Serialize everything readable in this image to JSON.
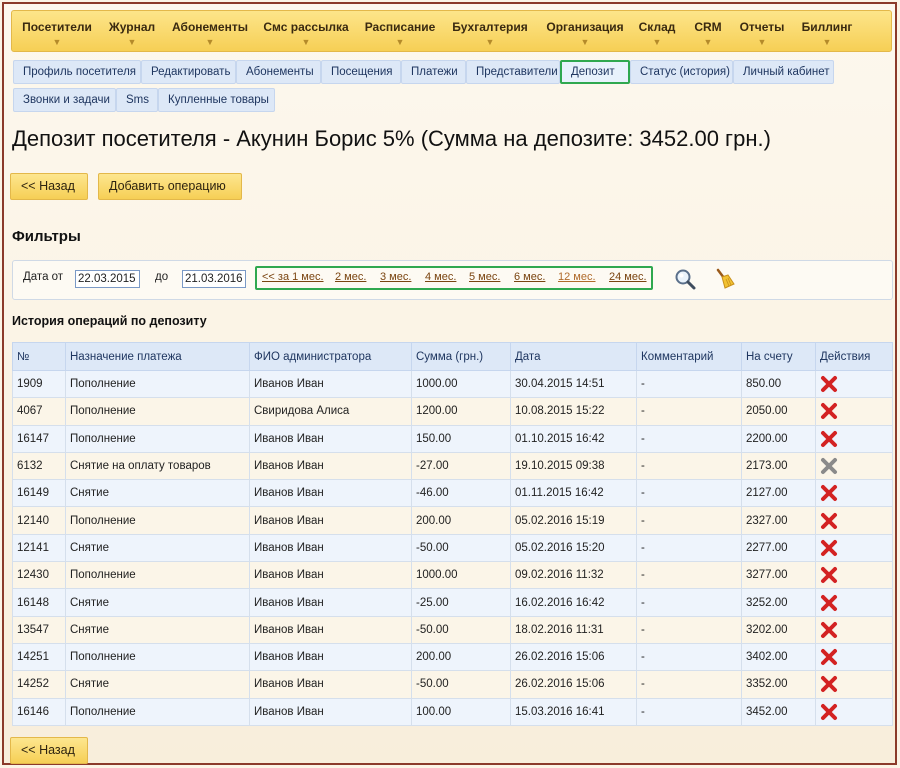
{
  "menu": [
    {
      "label": "Посетители"
    },
    {
      "label": "Журнал"
    },
    {
      "label": "Абонементы"
    },
    {
      "label": "Смс рассылка"
    },
    {
      "label": "Расписание"
    },
    {
      "label": "Бухгалтерия"
    },
    {
      "label": "Организация"
    },
    {
      "label": "Склад"
    },
    {
      "label": "CRM"
    },
    {
      "label": "Отчеты"
    },
    {
      "label": "Биллинг"
    }
  ],
  "menu_arrow": "▼",
  "tabs_row1": [
    {
      "label": "Профиль посетителя"
    },
    {
      "label": "Редактировать"
    },
    {
      "label": "Абонементы"
    },
    {
      "label": "Посещения"
    },
    {
      "label": "Платежи"
    },
    {
      "label": "Представители"
    },
    {
      "label": "Депозит"
    },
    {
      "label": "Статус (история)"
    },
    {
      "label": "Личный кабинет"
    }
  ],
  "tabs_row2": [
    {
      "label": "Звонки и задачи"
    },
    {
      "label": "Sms"
    },
    {
      "label": "Купленные товары"
    }
  ],
  "active_tab": "Депозит",
  "page_title": "Депозит посетителя - Акунин Борис 5% (Сумма на депозите: 3452.00 грн.)",
  "buttons": {
    "back": "<< Назад",
    "add_operation": "Добавить операцию"
  },
  "filters": {
    "title": "Фильтры",
    "date_from_label": "Дата от",
    "date_from": "22.03.2015",
    "date_to_label": "до",
    "date_to": "21.03.2016",
    "periods": [
      "<< за 1 мес.",
      "2 мес.",
      "3 мес.",
      "4 мес.",
      "5 мес.",
      "6 мес.",
      "12 мес.",
      "24 мес."
    ],
    "search_icon": "magnifier-icon",
    "clear_icon": "broom-icon"
  },
  "history": {
    "title": "История операций по депозиту",
    "columns": [
      "№",
      "Назначение платежа",
      "ФИО администратора",
      "Сумма (грн.)",
      "Дата",
      "Комментарий",
      "На счету",
      "Действия"
    ],
    "rows": [
      {
        "id": "1909",
        "purpose": "Пополнение",
        "admin": "Иванов Иван",
        "amount": "1000.00",
        "sign": "pos",
        "date": "30.04.2015 14:51",
        "comment": "-",
        "balance": "850.00",
        "deletable": true
      },
      {
        "id": "4067",
        "purpose": "Пополнение",
        "admin": "Свиридова Алиса",
        "amount": "1200.00",
        "sign": "pos",
        "date": "10.08.2015 15:22",
        "comment": "-",
        "balance": "2050.00",
        "deletable": true
      },
      {
        "id": "16147",
        "purpose": "Пополнение",
        "admin": "Иванов Иван",
        "amount": "150.00",
        "sign": "pos",
        "date": "01.10.2015 16:42",
        "comment": "-",
        "balance": "2200.00",
        "deletable": true
      },
      {
        "id": "6132",
        "purpose": "Снятие на оплату товаров",
        "admin": "Иванов Иван",
        "amount": "-27.00",
        "sign": "neg",
        "date": "19.10.2015 09:38",
        "comment": "-",
        "balance": "2173.00",
        "deletable": false
      },
      {
        "id": "16149",
        "purpose": "Снятие",
        "admin": "Иванов Иван",
        "amount": "-46.00",
        "sign": "neg",
        "date": "01.11.2015 16:42",
        "comment": "-",
        "balance": "2127.00",
        "deletable": true
      },
      {
        "id": "12140",
        "purpose": "Пополнение",
        "admin": "Иванов Иван",
        "amount": "200.00",
        "sign": "pos",
        "date": "05.02.2016 15:19",
        "comment": "-",
        "balance": "2327.00",
        "deletable": true
      },
      {
        "id": "12141",
        "purpose": "Снятие",
        "admin": "Иванов Иван",
        "amount": "-50.00",
        "sign": "neg",
        "date": "05.02.2016 15:20",
        "comment": "-",
        "balance": "2277.00",
        "deletable": true
      },
      {
        "id": "12430",
        "purpose": "Пополнение",
        "admin": "Иванов Иван",
        "amount": "1000.00",
        "sign": "pos",
        "date": "09.02.2016 11:32",
        "comment": "-",
        "balance": "3277.00",
        "deletable": true
      },
      {
        "id": "16148",
        "purpose": "Снятие",
        "admin": "Иванов Иван",
        "amount": "-25.00",
        "sign": "neg",
        "date": "16.02.2016 16:42",
        "comment": "-",
        "balance": "3252.00",
        "deletable": true
      },
      {
        "id": "13547",
        "purpose": "Снятие",
        "admin": "Иванов Иван",
        "amount": "-50.00",
        "sign": "neg",
        "date": "18.02.2016 11:31",
        "comment": "-",
        "balance": "3202.00",
        "deletable": true
      },
      {
        "id": "14251",
        "purpose": "Пополнение",
        "admin": "Иванов Иван",
        "amount": "200.00",
        "sign": "pos",
        "date": "26.02.2016 15:06",
        "comment": "-",
        "balance": "3402.00",
        "deletable": true
      },
      {
        "id": "14252",
        "purpose": "Снятие",
        "admin": "Иванов Иван",
        "amount": "-50.00",
        "sign": "neg",
        "date": "26.02.2016 15:06",
        "comment": "-",
        "balance": "3352.00",
        "deletable": true
      },
      {
        "id": "16146",
        "purpose": "Пополнение",
        "admin": "Иванов Иван",
        "amount": "100.00",
        "sign": "pos",
        "date": "15.03.2016 16:41",
        "comment": "-",
        "balance": "3452.00",
        "deletable": true
      }
    ],
    "delete_icon": "delete-cross-icon"
  },
  "colors": {
    "menu_bg": "#f6cf55",
    "tab_bg": "#dde8f7",
    "active_tab_border": "#2fa84f",
    "positive_amount": "#2a7a22",
    "negative_amount": "#d32222",
    "delete_active": "#d32222",
    "delete_disabled": "#8a8a8a"
  }
}
